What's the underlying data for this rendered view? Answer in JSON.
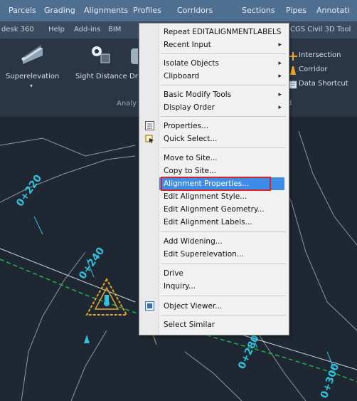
{
  "menubar": {
    "items": [
      "Parcels",
      "Grading",
      "Alignments",
      "Profiles",
      "Corridors",
      "Sections",
      "Pipes",
      "Annotati"
    ]
  },
  "ribbon_tabs": {
    "items": [
      "desk 360",
      "Help",
      "Add-ins",
      "BIM",
      "CGS Civil 3D Tool"
    ]
  },
  "ribbon": {
    "superelevation": "Superelevation",
    "sight_distance": "Sight Distance",
    "dr_trunc": "Dr",
    "panel_analysis": "Analy",
    "panel_right_trunc": "d",
    "intersection": "Intersection",
    "corridor": "Corridor",
    "data_shortcut": "Data Shortcut"
  },
  "drawing": {
    "stations": [
      "0+220",
      "0+240",
      "0+280",
      "0+300"
    ]
  },
  "context_menu": {
    "items": [
      {
        "label": "Repeat EDITALIGNMENTLABELS",
        "submenu": false
      },
      {
        "label": "Recent Input",
        "submenu": true
      },
      {
        "label": "Isolate Objects",
        "submenu": true
      },
      {
        "label": "Clipboard",
        "submenu": true
      },
      {
        "label": "Basic Modify Tools",
        "submenu": true
      },
      {
        "label": "Display Order",
        "submenu": true
      },
      {
        "label": "Properties...",
        "submenu": false
      },
      {
        "label": "Quick Select...",
        "submenu": false
      },
      {
        "label": "Move to Site...",
        "submenu": false
      },
      {
        "label": "Copy to Site...",
        "submenu": false
      },
      {
        "label": "Alignment Properties...",
        "submenu": false,
        "highlighted": true
      },
      {
        "label": "Edit Alignment Style...",
        "submenu": false
      },
      {
        "label": "Edit Alignment Geometry...",
        "submenu": false
      },
      {
        "label": "Edit Alignment Labels...",
        "submenu": false
      },
      {
        "label": "Add Widening...",
        "submenu": false
      },
      {
        "label": "Edit Superelevation...",
        "submenu": false
      },
      {
        "label": "Drive",
        "submenu": false
      },
      {
        "label": "Inquiry...",
        "submenu": true
      },
      {
        "label": "Object Viewer...",
        "submenu": false
      },
      {
        "label": "Select Similar",
        "submenu": false
      }
    ],
    "submenu_arrow": "▸"
  },
  "colors": {
    "menubar": "#4f6f91",
    "ribbon": "#2a3644",
    "drawing": "#1f2732",
    "highlight": "#3d8ce8",
    "focus_outline": "#d32626",
    "station_label": "#2ec4e0"
  },
  "icons": {
    "properties": "properties-icon",
    "quick_select": "quick-select-icon",
    "object_viewer": "object-viewer-icon",
    "superelevation": "superelevation-icon",
    "sight_distance": "sight-distance-icon",
    "intersection": "intersection-icon",
    "corridor": "corridor-icon",
    "data_shortcut": "data-shortcut-icon"
  }
}
